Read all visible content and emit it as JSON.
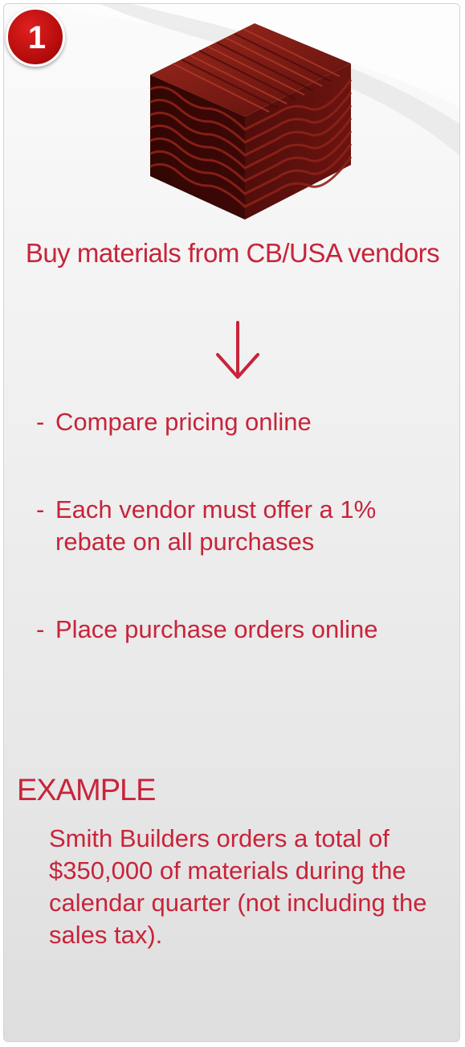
{
  "step": {
    "number": "1"
  },
  "image": {
    "icon": "corrugated-roofing-stack-icon"
  },
  "headline": "Buy materials from CB/USA vendors",
  "bullets": [
    {
      "dash": "-",
      "text": "Compare pricing online"
    },
    {
      "dash": "-",
      "text": "Each vendor must offer a 1% rebate on all purchases"
    },
    {
      "dash": "-",
      "text": "Place purchase orders online"
    }
  ],
  "example": {
    "heading": "EXAMPLE",
    "body": "Smith Builders orders a total of $350,000 of materials during the calendar quarter (not including the sales tax)."
  },
  "colors": {
    "accent": "#c8243a",
    "badge": "#b80d0d",
    "material": "#6b1410"
  }
}
